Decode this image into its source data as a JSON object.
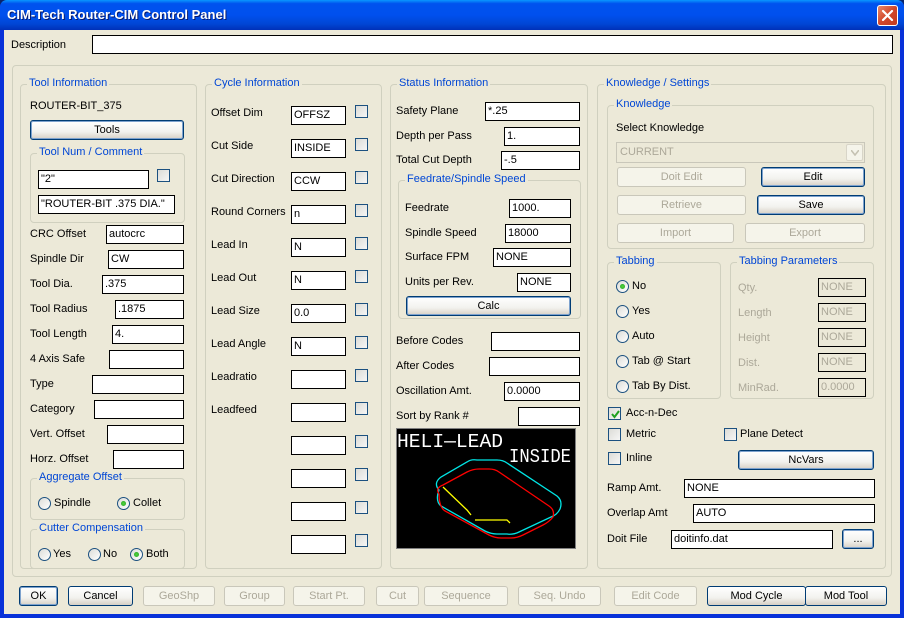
{
  "window": {
    "title": "CIM-Tech Router-CIM Control Panel"
  },
  "description": {
    "label": "Description",
    "value": ""
  },
  "tool_info": {
    "legend": "Tool Information",
    "tool_name": "ROUTER-BIT_375",
    "tools_button": "Tools",
    "tool_num_comment": {
      "legend": "Tool Num / Comment",
      "tool_num": "\"2\"",
      "comment": "\"ROUTER-BIT .375 DIA.\"",
      "checked": false
    },
    "fields": [
      {
        "label": "CRC Offset",
        "value": "autocrc"
      },
      {
        "label": "Spindle Dir",
        "value": "CW"
      },
      {
        "label": "Tool Dia.",
        "value": ".375"
      },
      {
        "label": "Tool Radius",
        "value": ".1875"
      },
      {
        "label": "Tool Length",
        "value": "4."
      },
      {
        "label": "4 Axis Safe",
        "value": ""
      },
      {
        "label": "Type",
        "value": ""
      },
      {
        "label": "Category",
        "value": ""
      },
      {
        "label": "Vert. Offset",
        "value": ""
      },
      {
        "label": "Horz. Offset",
        "value": ""
      }
    ],
    "aggregate_offset": {
      "legend": "Aggregate Offset",
      "options": [
        "Spindle",
        "Collet"
      ],
      "selected": "Collet"
    },
    "cutter_compensation": {
      "legend": "Cutter Compensation",
      "options": [
        "Yes",
        "No",
        "Both"
      ],
      "selected": "Both"
    }
  },
  "cycle_info": {
    "legend": "Cycle Information",
    "rows": [
      {
        "label": "Offset Dim",
        "value": "OFFSZ",
        "checked": false
      },
      {
        "label": "Cut Side",
        "value": "INSIDE",
        "checked": false
      },
      {
        "label": "Cut Direction",
        "value": "CCW",
        "checked": false
      },
      {
        "label": "Round Corners",
        "value": "n",
        "checked": false
      },
      {
        "label": "Lead In",
        "value": "N",
        "checked": false
      },
      {
        "label": "Lead Out",
        "value": "N",
        "checked": false
      },
      {
        "label": "Lead Size",
        "value": "0.0",
        "checked": false
      },
      {
        "label": "Lead Angle",
        "value": "N",
        "checked": false
      },
      {
        "label": "Leadratio",
        "value": "",
        "checked": false
      },
      {
        "label": "Leadfeed",
        "value": "",
        "checked": false
      },
      {
        "label": "",
        "value": "",
        "checked": false
      },
      {
        "label": "",
        "value": "",
        "checked": false
      },
      {
        "label": "",
        "value": "",
        "checked": false
      },
      {
        "label": "",
        "value": "",
        "checked": false
      }
    ]
  },
  "status_info": {
    "legend": "Status Information",
    "fields": [
      {
        "label": "Safety Plane",
        "value": "*.25"
      },
      {
        "label": "Depth per Pass",
        "value": "1."
      },
      {
        "label": "Total Cut Depth",
        "value": "-.5"
      }
    ],
    "feed_speed": {
      "legend": "Feedrate/Spindle Speed",
      "fields": [
        {
          "label": "Feedrate",
          "value": "1000."
        },
        {
          "label": "Spindle Speed",
          "value": "18000"
        },
        {
          "label": "Surface FPM",
          "value": "NONE"
        },
        {
          "label": "Units per Rev.",
          "value": "NONE"
        }
      ],
      "calc_button": "Calc"
    },
    "extra_fields": [
      {
        "label": "Before Codes",
        "value": ""
      },
      {
        "label": "After Codes",
        "value": ""
      },
      {
        "label": "Oscillation Amt.",
        "value": "0.0000"
      },
      {
        "label": "Sort by Rank #",
        "value": ""
      }
    ],
    "preview": {
      "line1": "HELI—LEAD",
      "line2": "INSIDE",
      "colors": {
        "outer": "#00E5E5",
        "inner": "#FF0000",
        "lead": "#FFFF00",
        "text": "#FFFFFF"
      }
    }
  },
  "knowledge_settings": {
    "legend": "Knowledge / Settings",
    "knowledge": {
      "legend": "Knowledge",
      "select_label": "Select Knowledge",
      "selected": "CURRENT",
      "buttons": {
        "doit_edit": "Doit Edit",
        "edit": "Edit",
        "retrieve": "Retrieve",
        "save": "Save",
        "import": "Import",
        "export": "Export"
      }
    },
    "tabbing": {
      "legend": "Tabbing",
      "options": [
        "No",
        "Yes",
        "Auto",
        "Tab @ Start",
        "Tab By Dist."
      ],
      "selected": "No"
    },
    "tabbing_params": {
      "legend": "Tabbing Parameters",
      "fields": [
        {
          "label": "Qty.",
          "value": "NONE"
        },
        {
          "label": "Length",
          "value": "NONE"
        },
        {
          "label": "Height",
          "value": "NONE"
        },
        {
          "label": "Dist.",
          "value": "NONE"
        },
        {
          "label": "MinRad.",
          "value": "0.0000"
        }
      ]
    },
    "checks": {
      "acc_n_dec": {
        "label": "Acc-n-Dec",
        "checked": true
      },
      "metric": {
        "label": "Metric",
        "checked": false
      },
      "plane_detect": {
        "label": "Plane Detect",
        "checked": false
      },
      "inline": {
        "label": "Inline",
        "checked": false
      }
    },
    "ncvars_button": "NcVars",
    "ramp": {
      "label": "Ramp Amt.",
      "value": "NONE"
    },
    "overlap": {
      "label": "Overlap Amt",
      "value": "AUTO"
    },
    "doit_file": {
      "label": "Doit File",
      "value": "doitinfo.dat",
      "browse": "..."
    }
  },
  "bottom_buttons": [
    {
      "label": "OK",
      "enabled": true
    },
    {
      "label": "Cancel",
      "enabled": true
    },
    {
      "label": "GeoShp",
      "enabled": false
    },
    {
      "label": "Group",
      "enabled": false
    },
    {
      "label": "Start Pt.",
      "enabled": false
    },
    {
      "label": "Cut",
      "enabled": false
    },
    {
      "label": "Sequence",
      "enabled": false
    },
    {
      "label": "Seq. Undo",
      "enabled": false
    },
    {
      "label": "Edit Code",
      "enabled": false
    },
    {
      "label": "Mod Cycle",
      "enabled": true
    },
    {
      "label": "Mod Tool",
      "enabled": true
    }
  ]
}
